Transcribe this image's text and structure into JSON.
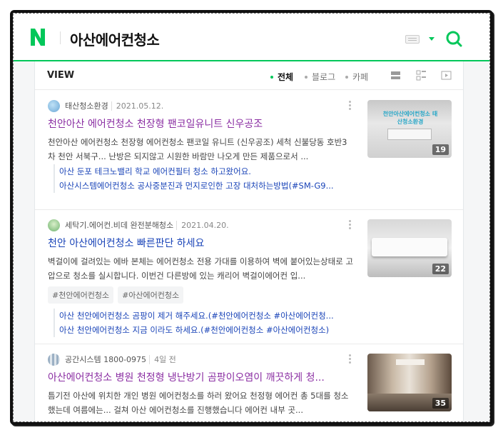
{
  "header": {
    "query": "아산에어컨청소",
    "logo_letter": "N",
    "brand_color": "#03c75a"
  },
  "view": {
    "title": "VIEW",
    "filters": [
      {
        "label": "전체",
        "active": true
      },
      {
        "label": "블로그",
        "active": false
      },
      {
        "label": "카페",
        "active": false
      }
    ]
  },
  "items": [
    {
      "author": "태산청소환경",
      "date": "2021.05.12.",
      "title": "천안아산 에어컨청소 천장형 팬코일유니트 신우공조",
      "desc": "천안아산 에어컨청소 천장형 에어컨청소 팬코일 유니트 (신우공조) 세척 신불당동 호반3차 천안 서북구... 난방은 되지않고 시원한 바람만 나오게 만든 제품으로서 ...",
      "thumb_count": "19",
      "thumb_caption": "천안아산에어컨청소 태산청소환경",
      "subs": [
        "아산 둔포 테크노밸리 학교 에어컨필터 청소 하고왔어요.",
        "아산시스템에어컨청소 공사중분진과 먼지로인한 고장 대처하는방법(#SM-G9..."
      ]
    },
    {
      "author": "세탁기.에어컨.비데 완전분해청소",
      "date": "2021.04.20.",
      "title": "천안 아산에어컨청소 빠른판단 하세요",
      "desc": "벽걸이에 걸려있는 에바 본체는 에어컨청소 전용 가대를 이용하여 벽에 붙어있는상태로 고압으로 청소를 실시합니다. 이번건 다른방에 있는 캐리어 벽걸이에어컨 입...",
      "thumb_count": "22",
      "tags": [
        "#천안에어컨청소",
        "#아산에어컨청소"
      ],
      "subs": [
        "아산 천안에어컨청소 곰팡이 제거 해주세요.(#천안에어컨청소 #아산에어컨청...",
        "아산 천안에어컨청소 지금 이라도 하세요.(#천안에어컨청소 #아산에어컨청소)"
      ]
    },
    {
      "author": "공간시스템 1800-0975",
      "date": "4일 전",
      "title": "아산에어컨청소 병원 천정형 냉난방기 곰팡이오염이 깨끗하게 청...",
      "desc": "틈기전 아산에 위치한 개인 병원 에어컨청소를 하러 왔어요 천정형 에어컨 총 5대를 청소했는데 여름에는... 걸쳐 아산 에어컨청소를 진행했습니다 에어컨 내부 곳...",
      "thumb_count": "35"
    }
  ]
}
